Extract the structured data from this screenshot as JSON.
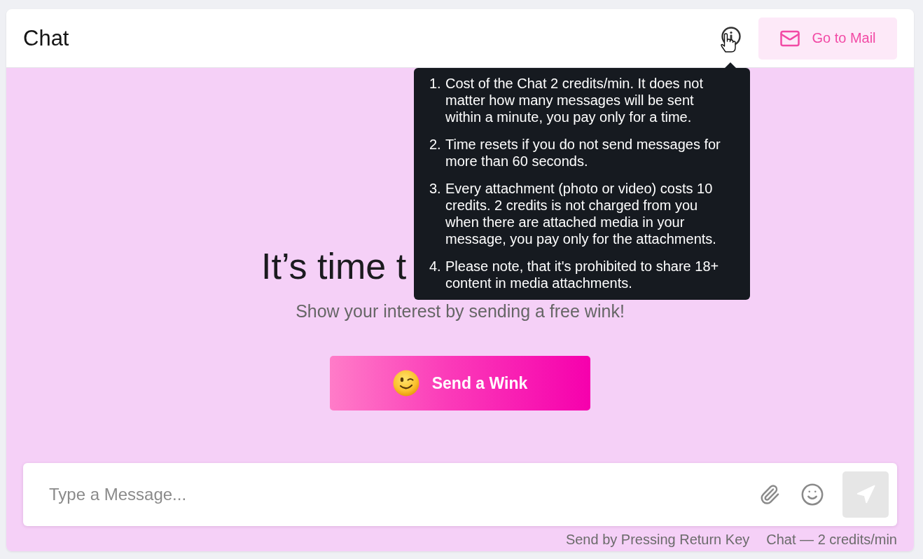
{
  "header": {
    "title": "Chat",
    "mail_button": {
      "label": "Go to Mail"
    }
  },
  "tooltip": {
    "items": [
      {
        "number": "1.",
        "text": "Cost of the Chat 2 credits/min. It does not matter how many messages will be sent within a minute, you pay only for a time."
      },
      {
        "number": "2.",
        "text": "Time resets if you do not send messages for more than 60 seconds."
      },
      {
        "number": "3.",
        "text": "Every attachment (photo or video) costs 10 credits. 2 credits is not charged from you when there are attached media in your message, you pay only for the attachments."
      },
      {
        "number": "4.",
        "text": "Please note, that it's prohibited to share 18+ content in media attachments."
      }
    ]
  },
  "hero": {
    "heading": "It’s time t",
    "subtitle": "Show your interest by sending a free wink!",
    "wink_button": {
      "label": "Send a Wink"
    }
  },
  "composer": {
    "placeholder": "Type a Message...",
    "send_button": {
      "disabled": true
    }
  },
  "footer": {
    "hint": "Send by Pressing Return Key",
    "pricing": "Chat — 2 credits/min"
  }
}
